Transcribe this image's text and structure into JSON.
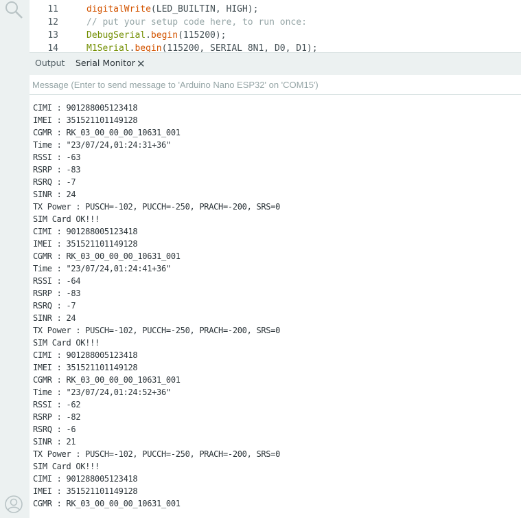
{
  "editor": {
    "lines": [
      {
        "num": "11",
        "parts": [
          {
            "t": "digitalWrite",
            "c": "fn"
          },
          {
            "t": "(LED_BUILTIN, HIGH);",
            "c": "tx"
          }
        ]
      },
      {
        "num": "12",
        "parts": [
          {
            "t": "// put your setup code here, to run once:",
            "c": "cm"
          }
        ]
      },
      {
        "num": "13",
        "parts": [
          {
            "t": "DebugSerial",
            "c": "kw"
          },
          {
            "t": ".",
            "c": "tx"
          },
          {
            "t": "begin",
            "c": "fn"
          },
          {
            "t": "(115200);",
            "c": "tx"
          }
        ]
      },
      {
        "num": "14",
        "parts": [
          {
            "t": "M1Serial",
            "c": "kw"
          },
          {
            "t": ".",
            "c": "tx"
          },
          {
            "t": "begin",
            "c": "fn"
          },
          {
            "t": "(115200, SERIAL_8N1, D0, D1);",
            "c": "tx"
          }
        ]
      }
    ]
  },
  "panel": {
    "tab_output": "Output",
    "tab_serial": "Serial Monitor",
    "close_glyph": "✕"
  },
  "message": {
    "placeholder": "Message (Enter to send message to 'Arduino Nano ESP32' on 'COM15')"
  },
  "serial_lines": [
    "CIMI : 901288005123418",
    "IMEI : 351521101149128",
    "CGMR : RK_03_00_00_00_10631_001",
    "Time : \"23/07/24,01:24:31+36\"",
    "RSSI : -63",
    "RSRP : -83",
    "RSRQ : -7",
    "SINR : 24",
    "TX Power : PUSCH=-102, PUCCH=-250, PRACH=-200, SRS=0",
    "SIM Card OK!!!",
    "CIMI : 901288005123418",
    "IMEI : 351521101149128",
    "CGMR : RK_03_00_00_00_10631_001",
    "Time : \"23/07/24,01:24:41+36\"",
    "RSSI : -64",
    "RSRP : -83",
    "RSRQ : -7",
    "SINR : 24",
    "TX Power : PUSCH=-102, PUCCH=-250, PRACH=-200, SRS=0",
    "SIM Card OK!!!",
    "CIMI : 901288005123418",
    "IMEI : 351521101149128",
    "CGMR : RK_03_00_00_00_10631_001",
    "Time : \"23/07/24,01:24:52+36\"",
    "RSSI : -62",
    "RSRP : -82",
    "RSRQ : -6",
    "SINR : 21",
    "TX Power : PUSCH=-102, PUCCH=-250, PRACH=-200, SRS=0",
    "SIM Card OK!!!",
    "CIMI : 901288005123418",
    "IMEI : 351521101149128",
    "CGMR : RK_03_00_00_00_10631_001"
  ],
  "icons": {
    "search": "search-icon",
    "profile": "profile-icon"
  }
}
